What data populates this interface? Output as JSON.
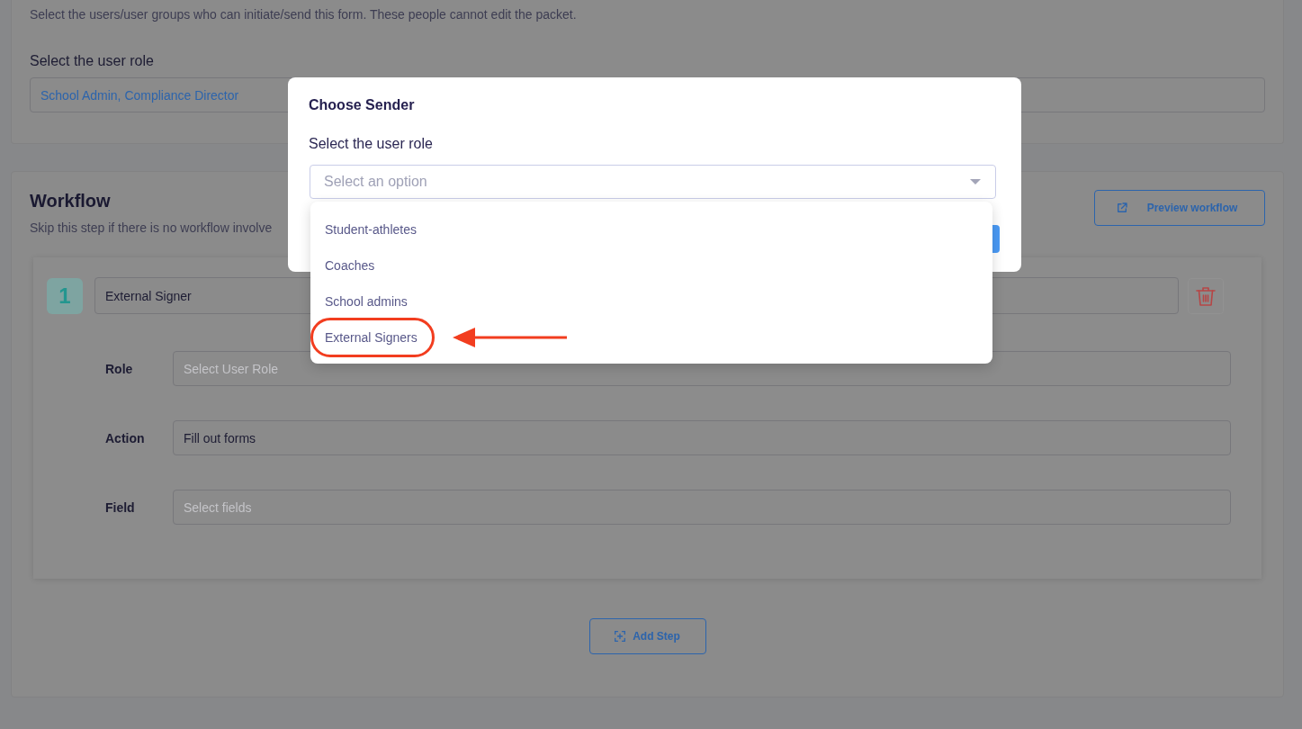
{
  "sender_section": {
    "description": "Select the users/user groups who can initiate/send this form. These people cannot edit the packet.",
    "role_label": "Select the user role",
    "role_value": "School Admin, Compliance Director"
  },
  "workflow": {
    "title": "Workflow",
    "subtitle": "Skip this step if there is no workflow involve",
    "preview_button": "Preview workflow",
    "steps": [
      {
        "number": "1",
        "name": "External Signer",
        "fields": [
          {
            "label": "Role",
            "placeholder": "Select User Role"
          },
          {
            "label": "Action",
            "value": "Fill out forms"
          },
          {
            "label": "Field",
            "placeholder": "Select fields"
          }
        ]
      }
    ],
    "add_step_button": "Add Step"
  },
  "modal": {
    "title": "Choose Sender",
    "label": "Select the user role",
    "select": {
      "placeholder": "Select an option",
      "expanded": true
    },
    "options": [
      {
        "label": "Student-athletes",
        "circled": false
      },
      {
        "label": "Coaches",
        "circled": false
      },
      {
        "label": "School admins",
        "circled": false
      },
      {
        "label": "External Signers",
        "circled": true
      }
    ]
  }
}
